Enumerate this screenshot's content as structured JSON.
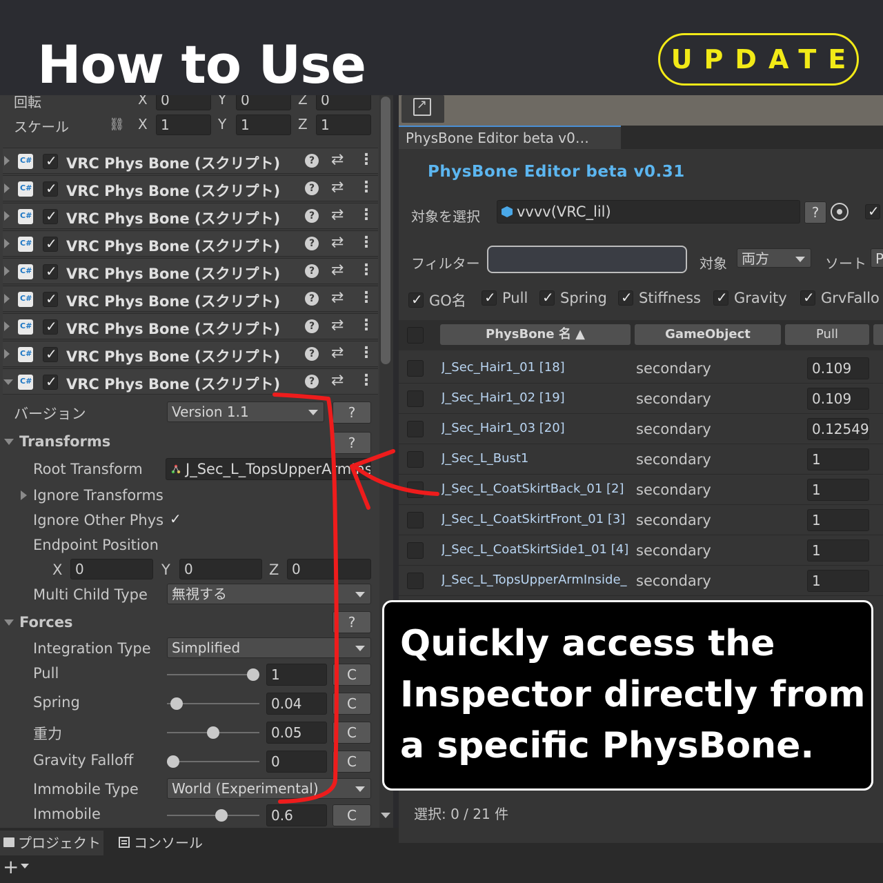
{
  "banner": {
    "title": "How to Use",
    "badge": "UPDATE"
  },
  "transform": {
    "rotation_label": "回転",
    "scale_label": "スケール",
    "rotation": {
      "x": "0",
      "y": "0",
      "z": "0"
    },
    "scale": {
      "x": "1",
      "y": "1",
      "z": "1"
    },
    "axis_x": "X",
    "axis_y": "Y",
    "axis_z": "Z"
  },
  "component_label": "VRC Phys Bone (スクリプト)",
  "inspector": {
    "version_label": "バージョン",
    "version_value": "Version 1.1",
    "help": "?",
    "transforms_section": "Transforms",
    "root_transform_label": "Root Transform",
    "root_transform_value": "J_Sec_L_TopsUpperArmInside",
    "ignore_transforms_label": "Ignore Transforms",
    "ignore_other_phys_label": "Ignore Other Phys",
    "endpoint_label": "Endpoint Position",
    "endpoint": {
      "x": "0",
      "y": "0",
      "z": "0"
    },
    "multi_child_label": "Multi Child Type",
    "multi_child_value": "無視する",
    "forces_section": "Forces",
    "integration_label": "Integration Type",
    "integration_value": "Simplified",
    "pull_label": "Pull",
    "pull_value": "1",
    "pull_level": 1.0,
    "spring_label": "Spring",
    "spring_value": "0.04",
    "spring_level": 0.04,
    "gravity_label": "重力",
    "gravity_value": "0.05",
    "gravity_level": 0.5,
    "gravity_falloff_label": "Gravity Falloff",
    "gravity_falloff_value": "0",
    "gravity_falloff_level": 0.0,
    "immobile_type_label": "Immobile Type",
    "immobile_type_value": "World (Experimental)",
    "immobile_label": "Immobile",
    "immobile_value": "0.6",
    "immobile_level": 0.6,
    "curve_btn": "C"
  },
  "bottom_tabs": {
    "project": "プロジェクト",
    "console": "コンソール",
    "add": "+"
  },
  "editor": {
    "tab_title": "PhysBone Editor beta v0…",
    "heading": "PhysBone Editor  beta  v0.31",
    "target_label": "対象を選択",
    "target_value": "vvvv(VRC_lil)",
    "help": "?",
    "filter_label": "フィルター",
    "scope_label": "対象",
    "scope_value": "両方",
    "sort_label": "ソート",
    "sort_value": "P",
    "column_toggles": [
      "GO名",
      "Pull",
      "Spring",
      "Stiffness",
      "Gravity",
      "GrvFallo"
    ],
    "headers": {
      "name": "PhysBone 名 ▲",
      "gameobject": "GameObject",
      "pull": "Pull"
    },
    "rows": [
      {
        "name": "J_Sec_Hair1_01 [18]",
        "go": "secondary",
        "pull": "0.109"
      },
      {
        "name": "J_Sec_Hair1_02 [19]",
        "go": "secondary",
        "pull": "0.109"
      },
      {
        "name": "J_Sec_Hair1_03 [20]",
        "go": "secondary",
        "pull": "0.12549"
      },
      {
        "name": "J_Sec_L_Bust1",
        "go": "secondary",
        "pull": "1"
      },
      {
        "name": "J_Sec_L_CoatSkirtBack_01 [2]",
        "go": "secondary",
        "pull": "1"
      },
      {
        "name": "J_Sec_L_CoatSkirtFront_01 [3]",
        "go": "secondary",
        "pull": "1"
      },
      {
        "name": "J_Sec_L_CoatSkirtSide1_01 [4]",
        "go": "secondary",
        "pull": "1"
      },
      {
        "name": "J_Sec_L_TopsUpperArmInside_",
        "go": "secondary",
        "pull": "1"
      }
    ],
    "selection_status": "選択: 0 / 21 件"
  },
  "callout": {
    "text": "Quickly access the Inspector directly from a specific PhysBone."
  },
  "colors": {
    "accent_yellow": "#f2ea17",
    "heading_blue": "#5cb6f0",
    "annotation_red": "#ee1c1c"
  }
}
